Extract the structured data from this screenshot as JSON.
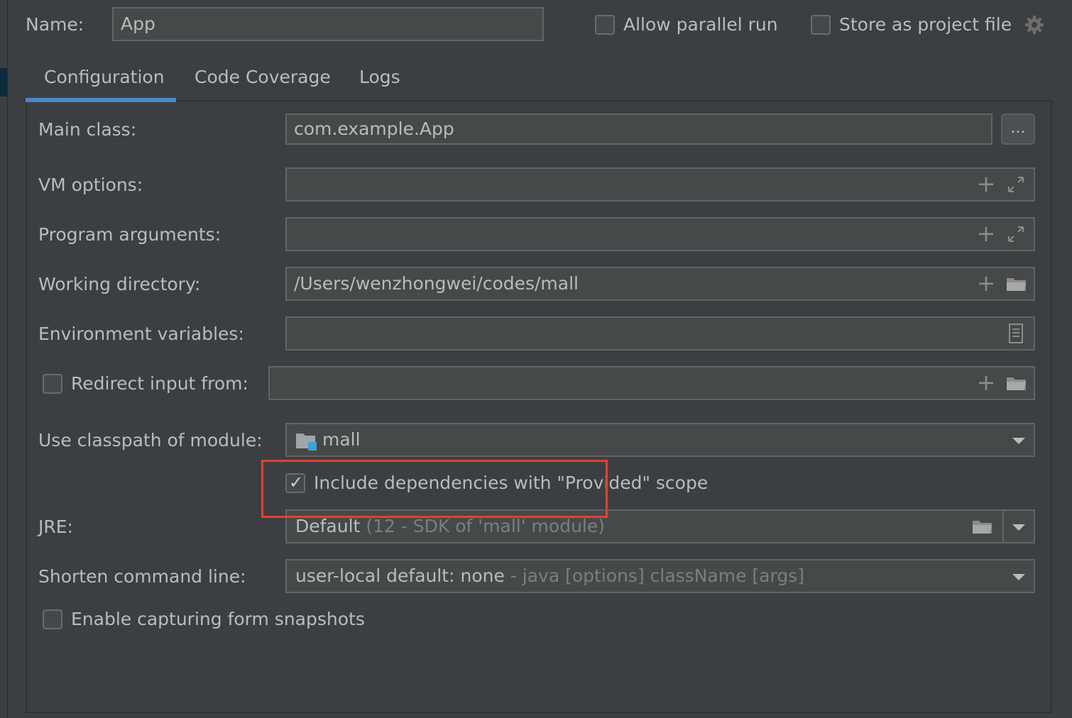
{
  "header": {
    "name_label": "Name:",
    "name_value": "App",
    "allow_parallel_label": "Allow parallel run",
    "store_project_label": "Store as project file"
  },
  "tabs": [
    {
      "label": "Configuration",
      "active": true
    },
    {
      "label": "Code Coverage",
      "active": false
    },
    {
      "label": "Logs",
      "active": false
    }
  ],
  "form": {
    "main_class_label": "Main class:",
    "main_class_value": "com.example.App",
    "browse_label": "...",
    "vm_options_label": "VM options:",
    "program_args_label": "Program arguments:",
    "working_dir_label": "Working directory:",
    "working_dir_value": "/Users/wenzhongwei/codes/mall",
    "env_vars_label": "Environment variables:",
    "redirect_input_label": "Redirect input from:",
    "classpath_label": "Use classpath of module:",
    "classpath_value": "mall",
    "include_provided_label": "Include dependencies with \"Provided\" scope",
    "include_provided_checked": true,
    "jre_label": "JRE:",
    "jre_value": "Default",
    "jre_hint": "(12 - SDK of 'mall' module)",
    "shorten_label": "Shorten command line:",
    "shorten_value": "user-local default: none",
    "shorten_hint": "- java [options] className [args]",
    "snapshots_label": "Enable capturing form snapshots"
  },
  "colors": {
    "background": "#3c3f41",
    "accent_tab": "#4a88c7",
    "highlight": "#e24232"
  }
}
